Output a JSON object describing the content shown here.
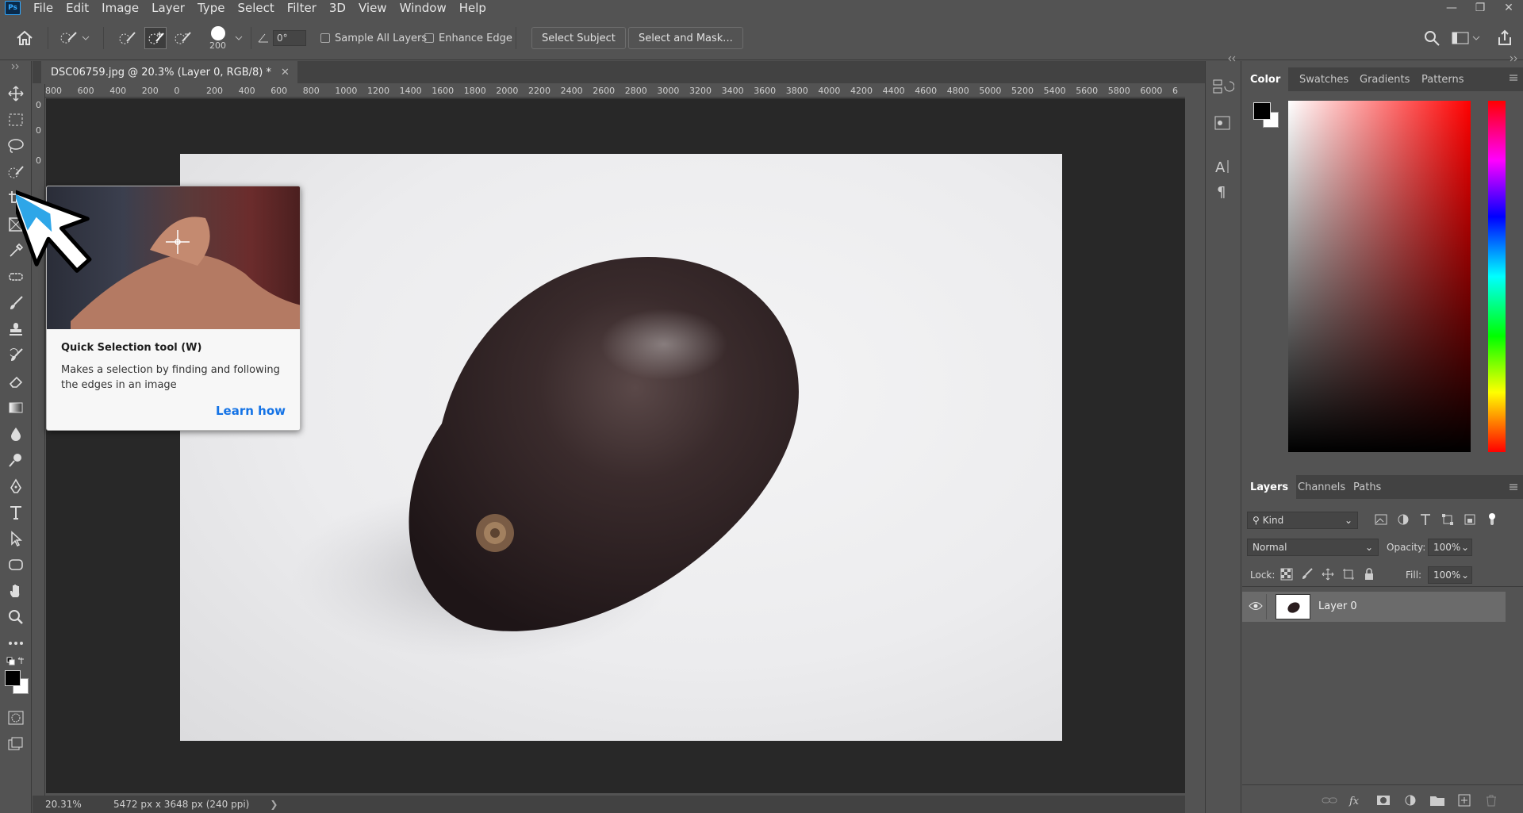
{
  "app": {
    "logo": "Ps"
  },
  "menu": [
    "File",
    "Edit",
    "Image",
    "Layer",
    "Type",
    "Select",
    "Filter",
    "3D",
    "View",
    "Window",
    "Help"
  ],
  "options": {
    "brush_size": "200",
    "angle": "0°",
    "sample_all_layers": "Sample All Layers",
    "enhance_edge": "Enhance Edge",
    "select_subject": "Select Subject",
    "select_and_mask": "Select and Mask..."
  },
  "document": {
    "tab_title": "DSC06759.jpg @ 20.3% (Layer 0, RGB/8) *",
    "zoom": "20.31%",
    "doc_info": "5472 px x 3648 px (240 ppi)"
  },
  "ruler": {
    "h_ticks": [
      "800",
      "600",
      "400",
      "200",
      "0",
      "200",
      "400",
      "600",
      "800",
      "1000",
      "1200",
      "1400",
      "1600",
      "1800",
      "2000",
      "2200",
      "2400",
      "2600",
      "2800",
      "3000",
      "3200",
      "3400",
      "3600",
      "3800",
      "4000",
      "4200",
      "4400",
      "4600",
      "4800",
      "5000",
      "5200",
      "5400",
      "5600",
      "5800",
      "6000",
      "6"
    ],
    "v_ticks": [
      "0",
      "0",
      "0"
    ]
  },
  "tooltip": {
    "title": "Quick Selection tool (W)",
    "description": "Makes a selection by finding and following the edges in an image",
    "link": "Learn how"
  },
  "color_panel": {
    "tabs": [
      "Color",
      "Swatches",
      "Gradients",
      "Patterns"
    ],
    "foreground": "#000000",
    "background": "#ffffff"
  },
  "layers_panel": {
    "tabs": [
      "Layers",
      "Channels",
      "Paths"
    ],
    "filter_kind": "Kind",
    "blend_mode": "Normal",
    "opacity_label": "Opacity:",
    "opacity_value": "100%",
    "lock_label": "Lock:",
    "fill_label": "Fill:",
    "fill_value": "100%",
    "layers": [
      {
        "name": "Layer 0"
      }
    ]
  },
  "colors": {
    "ui_bg": "#535353",
    "accent_link": "#1473e6",
    "canvas_bg": "#282828"
  }
}
